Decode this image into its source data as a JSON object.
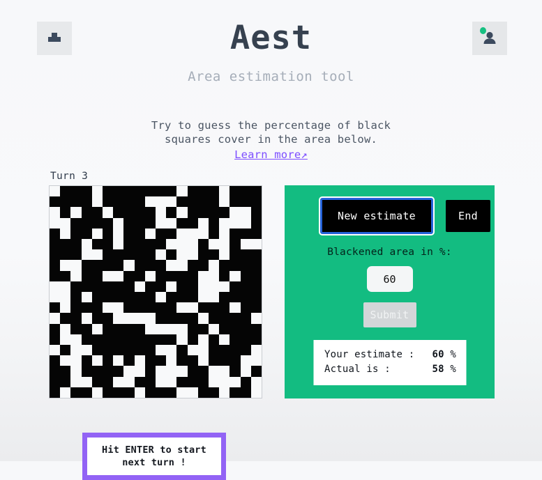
{
  "header": {
    "logo_icon": "stamp-icon",
    "title": "Aest",
    "subtitle": "Area estimation tool",
    "avatar_icon": "person-icon",
    "status": "online"
  },
  "instructions": {
    "line1": "Try to guess the percentage of black",
    "line2": "squares cover in the area below.",
    "link_label": "Learn more↗"
  },
  "game": {
    "turn_label": "Turn 3",
    "overlay": {
      "line1": "Hit ENTER to start",
      "line2": "next turn !"
    },
    "grid": {
      "rows": 20,
      "cols": 20,
      "black_color": "#050505",
      "white_color": "#f8f9fa",
      "pattern": [
        "10001000000010001000",
        "00001000011100001000",
        "10100100001010000110",
        "11000010001100101110",
        "01001010010011101000",
        "00010010000111011011",
        "00011000001011001000",
        "01100001000110010000",
        "00100110010000110100",
        "11000000100100111000",
        "11010000001000110000",
        "01000110000011000100",
        "10010011110000100001",
        "01001000011110010000",
        "01100000000010101000",
        "10110000001101100001",
        "01101010100100100011",
        "00100001101110011010",
        "00110011001100011101",
        "01001000100011001001"
      ]
    }
  },
  "panel": {
    "accent_color": "#13bc81",
    "new_estimate_label": "New estimate",
    "end_label": "End",
    "prompt": "Blackened area in %:",
    "input_value": "60",
    "input_placeholder": "",
    "submit_label": "Submit",
    "results": [
      {
        "label": "Your estimate :",
        "value": "60",
        "unit": "%"
      },
      {
        "label": "Actual is :",
        "value": "58",
        "unit": "%"
      }
    ]
  }
}
